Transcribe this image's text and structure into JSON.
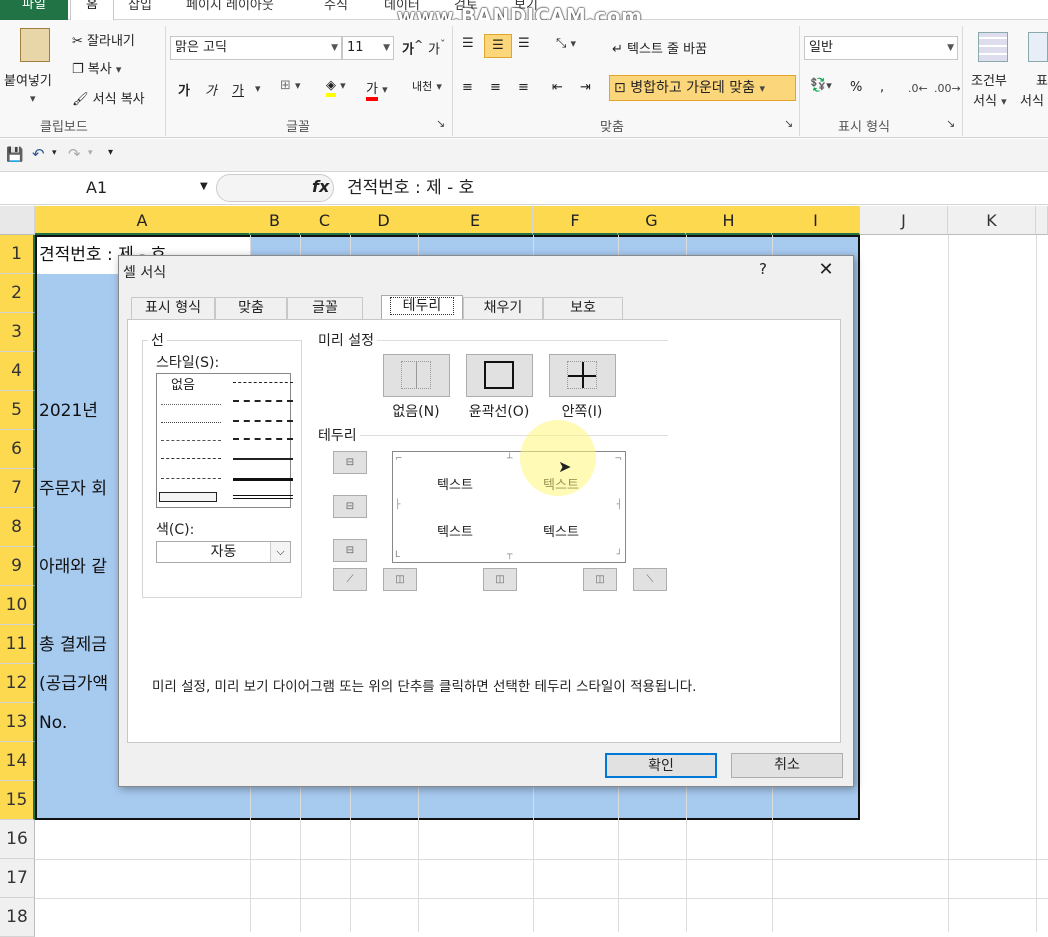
{
  "watermark": "www.BANDICAM.com",
  "ribbon_tabs": [
    "파일",
    "홈",
    "삽입",
    "페이지 레이아웃",
    "수식",
    "데이터",
    "검토",
    "보기"
  ],
  "clipboard": {
    "paste": "붙여넣기",
    "cut": "잘라내기",
    "copy": "복사",
    "format_painter": "서식 복사",
    "label": "클립보드"
  },
  "font": {
    "name": "맑은 고딕",
    "size": "11",
    "bold": "가",
    "italic": "가",
    "underline": "가",
    "label": "글꼴",
    "phonetic": "내천"
  },
  "alignment": {
    "wrap": "텍스트 줄 바꿈",
    "merge": "병합하고 가운데 맞춤",
    "label": "맞춤"
  },
  "number": {
    "format": "일반",
    "label": "표시 형식",
    "percent": "%",
    "comma": ","
  },
  "styles": {
    "conditional_line1": "조건부",
    "conditional_line2": "서식",
    "table_line1": "표",
    "table_line2": "서식"
  },
  "formula_bar": {
    "name_box": "A1",
    "fx": "fx",
    "formula": "견적번호 : 제  -  호"
  },
  "columns": [
    "A",
    "B",
    "C",
    "D",
    "E",
    "F",
    "G",
    "H",
    "I",
    "J",
    "K"
  ],
  "rows": [
    "1",
    "2",
    "3",
    "4",
    "5",
    "6",
    "7",
    "8",
    "9",
    "10",
    "11",
    "12",
    "13",
    "14",
    "15",
    "16",
    "17",
    "18"
  ],
  "cells": {
    "r1": "견적번호 : 제  -  호",
    "r5": "2021년",
    "r7": "주문자 회",
    "r9": "아래와 같",
    "r11": "총 결제금",
    "r12": "(공급가액",
    "r13": "No."
  },
  "dialog": {
    "title": "셀 서식",
    "help": "?",
    "close": "✕",
    "tabs": [
      "표시 형식",
      "맞춤",
      "글꼴",
      "테두리",
      "채우기",
      "보호"
    ],
    "active_tab": "테두리",
    "line_group": "선",
    "style_label": "스타일(S):",
    "style_none": "없음",
    "color_label": "색(C):",
    "color_value": "자동",
    "presets_label": "미리 설정",
    "presets": [
      "없음(N)",
      "윤곽선(O)",
      "안쪽(I)"
    ],
    "border_label": "테두리",
    "preview_text": "텍스트",
    "note": "미리 설정, 미리 보기 다이어그램 또는 위의 단추를 클릭하면 선택한 테두리 스타일이 적용됩니다.",
    "ok": "확인",
    "cancel": "취소"
  },
  "colors": {
    "excel_green": "#217346",
    "selection": "#a7caef",
    "header_selected": "#fdd94f",
    "accent_blue": "#0078d7"
  }
}
